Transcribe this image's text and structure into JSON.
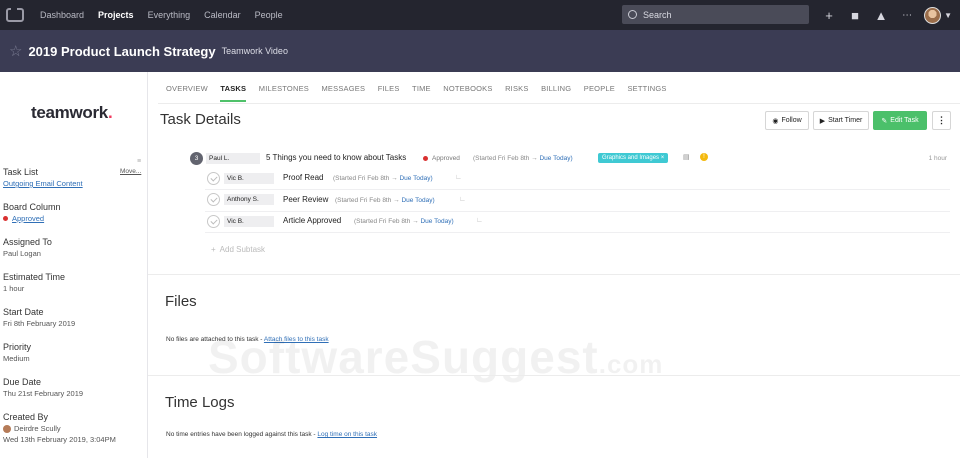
{
  "topnav": {
    "items": [
      "Dashboard",
      "Projects",
      "Everything",
      "Calendar",
      "People"
    ],
    "active": "Projects",
    "search_placeholder": "Search",
    "icons": [
      "plus-icon",
      "folder-icon",
      "bell-icon",
      "grid-icon",
      "avatar",
      "chevron-down-icon"
    ]
  },
  "project": {
    "name": "2019 Product Launch Strategy",
    "company": "Teamwork Video"
  },
  "sidebar": {
    "brand": "teamwork",
    "brand_dot": ".",
    "move_label": "Move...",
    "task_list_label": "Task List",
    "task_list_value": "Outgoing Email Content",
    "board_column_label": "Board Column",
    "board_column_value": "Approved",
    "assigned_to_label": "Assigned To",
    "assigned_to_value": "Paul Logan",
    "estimated_time_label": "Estimated Time",
    "estimated_time_value": "1 hour",
    "start_date_label": "Start Date",
    "start_date_value": "Fri 8th February 2019",
    "priority_label": "Priority",
    "priority_value": "Medium",
    "due_date_label": "Due Date",
    "due_date_value": "Thu 21st February 2019",
    "created_by_label": "Created By",
    "created_by_name": "Deirdre Scully",
    "created_by_date": "Wed 13th February 2019, 3:04PM"
  },
  "tabs": [
    "OVERVIEW",
    "TASKS",
    "MILESTONES",
    "MESSAGES",
    "FILES",
    "TIME",
    "NOTEBOOKS",
    "RISKS",
    "BILLING",
    "PEOPLE",
    "SETTINGS"
  ],
  "active_tab": "TASKS",
  "page_title": "Task Details",
  "buttons": {
    "follow": "Follow",
    "start_timer": "Start Timer",
    "edit_task": "Edit Task"
  },
  "task": {
    "subtask_count": "3",
    "assignee": "Paul L.",
    "name": "5 Things you need to know about Tasks",
    "status": "Approved",
    "started": "(Started Fri Feb 8th →",
    "due": "Due Today)",
    "tag": "Graphics and Images",
    "estimate": "1 hour"
  },
  "subtasks": [
    {
      "assignee": "Vic B.",
      "name": "Proof Read",
      "started": "(Started Fri Feb 8th →",
      "due": "Due Today)"
    },
    {
      "assignee": "Anthony S.",
      "name": "Peer Review",
      "started": "(Started Fri Feb 8th →",
      "due": "Due Today)"
    },
    {
      "assignee": "Vic B.",
      "name": "Article Approved",
      "started": "(Started Fri Feb 8th →",
      "due": "Due Today)"
    }
  ],
  "add_subtask": "Add Subtask",
  "files": {
    "title": "Files",
    "empty_text": "No files are attached to this task -",
    "link": "Attach files to this task"
  },
  "time_logs": {
    "title": "Time Logs",
    "empty_text": "No time entries have been logged against this task -",
    "link": "Log time on this task"
  },
  "watermark": {
    "main": "SoftwareSuggest",
    "suffix": ".com"
  },
  "colors": {
    "topnav_bg": "#24252f",
    "project_bar_bg": "#3b3c54",
    "accent_green": "#4bc06a",
    "tag_cyan": "#3fc9d3",
    "status_red": "#d93131",
    "link_blue": "#2f6fb7"
  }
}
